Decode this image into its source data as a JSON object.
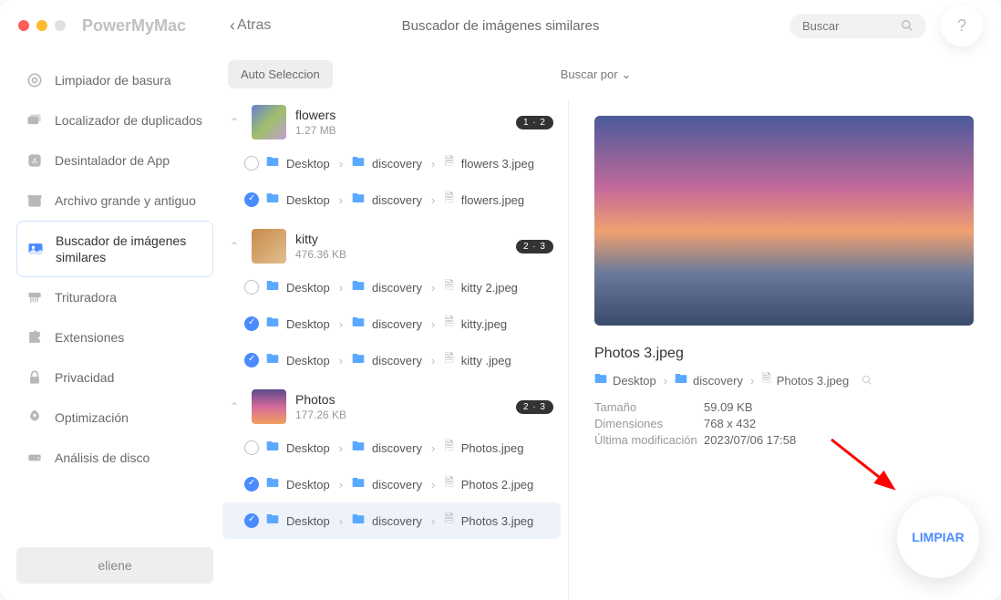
{
  "app": {
    "brand": "PowerMyMac",
    "back": "Atras",
    "title": "Buscador de imágenes similares",
    "search_placeholder": "Buscar",
    "help": "?"
  },
  "sidebar": {
    "items": [
      {
        "label": "Limpiador de basura",
        "icon": "gear-icon"
      },
      {
        "label": "Localizador de duplicados",
        "icon": "folders-icon"
      },
      {
        "label": "Desintalador de App",
        "icon": "app-icon"
      },
      {
        "label": "Archivo grande y antiguo",
        "icon": "archive-icon"
      },
      {
        "label": "Buscador de imágenes similares",
        "icon": "image-icon"
      },
      {
        "label": "Trituradora",
        "icon": "shredder-icon"
      },
      {
        "label": "Extensiones",
        "icon": "puzzle-icon"
      },
      {
        "label": "Privacidad",
        "icon": "lock-icon"
      },
      {
        "label": "Optimización",
        "icon": "rocket-icon"
      },
      {
        "label": "Análisis de disco",
        "icon": "disk-icon"
      }
    ],
    "user": "eliene"
  },
  "toolbar": {
    "auto_select": "Auto Seleccion",
    "sort_by": "Buscar por"
  },
  "groups": [
    {
      "title": "flowers",
      "size": "1.27 MB",
      "badge": "1 · 2",
      "rows": [
        {
          "checked": false,
          "crumbs": [
            "Desktop",
            "discovery"
          ],
          "file": "flowers 3.jpeg"
        },
        {
          "checked": true,
          "crumbs": [
            "Desktop",
            "discovery"
          ],
          "file": "flowers.jpeg"
        }
      ]
    },
    {
      "title": "kitty",
      "size": "476.36 KB",
      "badge": "2 · 3",
      "rows": [
        {
          "checked": false,
          "crumbs": [
            "Desktop",
            "discovery"
          ],
          "file": "kitty 2.jpeg"
        },
        {
          "checked": true,
          "crumbs": [
            "Desktop",
            "discovery"
          ],
          "file": "kitty.jpeg"
        },
        {
          "checked": true,
          "crumbs": [
            "Desktop",
            "discovery"
          ],
          "file": "kitty .jpeg"
        }
      ]
    },
    {
      "title": "Photos",
      "size": "177.26 KB",
      "badge": "2 · 3",
      "rows": [
        {
          "checked": false,
          "crumbs": [
            "Desktop",
            "discovery"
          ],
          "file": "Photos.jpeg"
        },
        {
          "checked": true,
          "crumbs": [
            "Desktop",
            "discovery"
          ],
          "file": "Photos 2.jpeg"
        },
        {
          "checked": true,
          "crumbs": [
            "Desktop",
            "discovery"
          ],
          "file": "Photos 3.jpeg",
          "selected": true
        }
      ]
    }
  ],
  "preview": {
    "title": "Photos 3.jpeg",
    "crumbs": [
      "Desktop",
      "discovery",
      "Photos 3.jpeg"
    ],
    "meta": {
      "size_k": "Tamaño",
      "size_v": "59.09 KB",
      "dim_k": "Dimensiones",
      "dim_v": "768 x 432",
      "mod_k": "Última modificación",
      "mod_v": "2023/07/06 17:58"
    }
  },
  "clean_label": "LIMPIAR"
}
